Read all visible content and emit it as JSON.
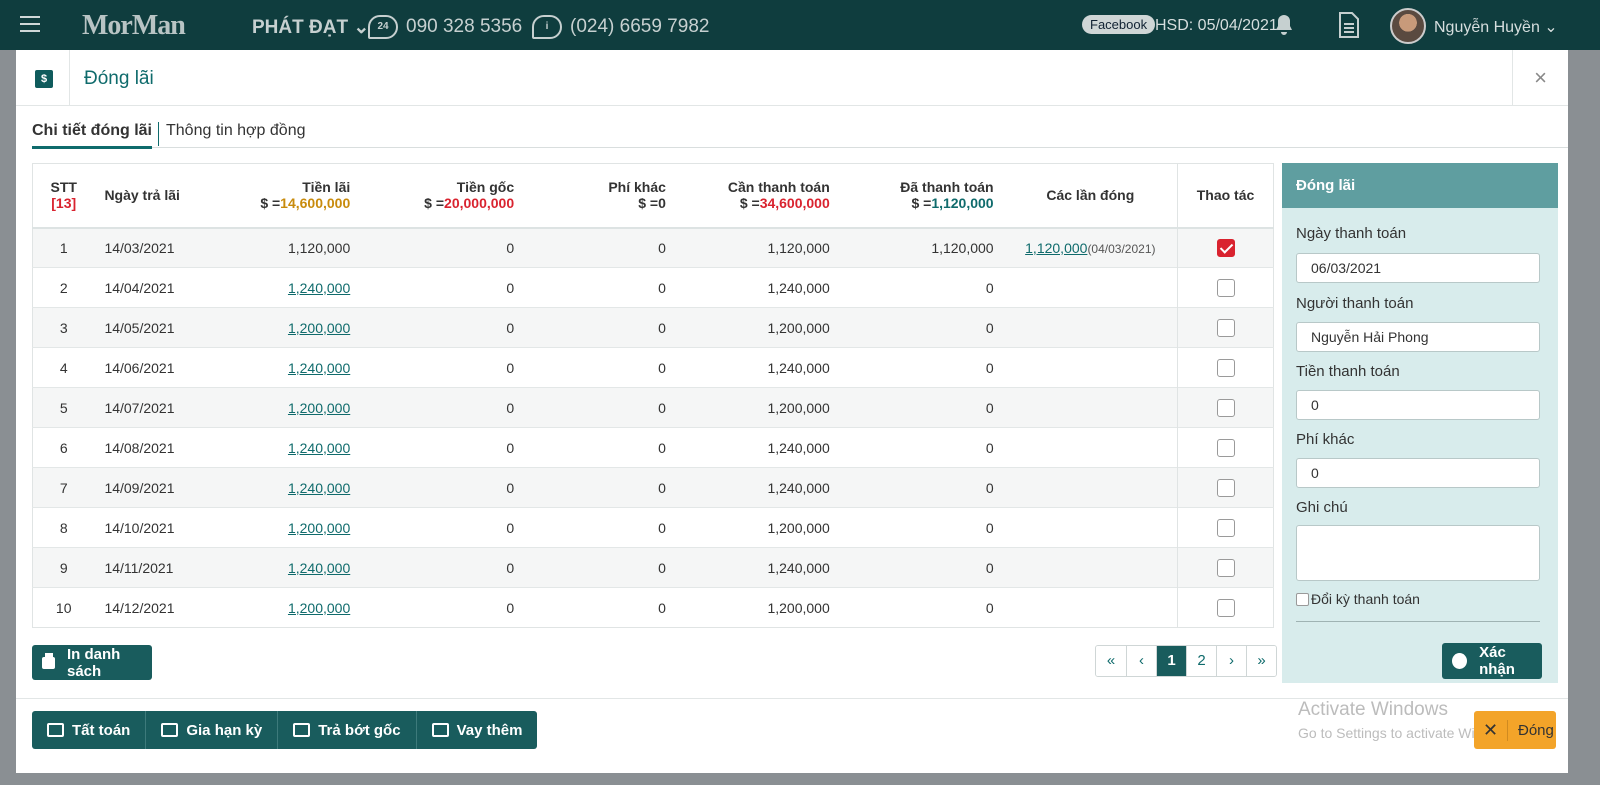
{
  "topbar": {
    "logo": "MorMan",
    "shop": "PHÁT ĐẠT",
    "phone1_badge": "24",
    "phone1": "090 328 5356",
    "phone2": "(024) 6659 7982",
    "facebook": "Facebook",
    "hsd": "HSD: 05/04/2021",
    "user": "Nguyễn Huyền"
  },
  "modal": {
    "icon_text": "$",
    "title": "Đóng lãi",
    "close": "×"
  },
  "tabs": [
    {
      "label": "Chi tiết đóng lãi"
    },
    {
      "label": "Thông tin hợp đồng"
    }
  ],
  "table": {
    "headers": {
      "stt": "STT",
      "stt_count": "[13]",
      "ngay": "Ngày trả lãi",
      "tienlai": "Tiền lãi",
      "tienlai_sum_prefix": "$ =",
      "tienlai_sum": "14,600,000",
      "tiengoc": "Tiền gốc",
      "tiengoc_sum_prefix": "$ =",
      "tiengoc_sum": "20,000,000",
      "phikhac": "Phí khác",
      "phikhac_sum_prefix": "$ =",
      "phikhac_sum": "0",
      "canthanhtoan": "Cần thanh toán",
      "can_sum_prefix": "$ =",
      "can_sum": "34,600,000",
      "dathanhtoan": "Đã thanh toán",
      "da_sum_prefix": "$ =",
      "da_sum": "1,120,000",
      "caclandong": "Các lần đóng",
      "thaotac": "Thao tác"
    },
    "rows": [
      {
        "stt": "1",
        "ngay": "14/03/2021",
        "lai": "1,120,000",
        "goc": "0",
        "phi": "0",
        "can": "1,120,000",
        "da": "1,120,000",
        "lan": "1,120,000",
        "lan_date": "(04/03/2021)"
      },
      {
        "stt": "2",
        "ngay": "14/04/2021",
        "lai": "1,240,000",
        "goc": "0",
        "phi": "0",
        "can": "1,240,000",
        "da": "0",
        "lan": "",
        "lan_date": ""
      },
      {
        "stt": "3",
        "ngay": "14/05/2021",
        "lai": "1,200,000",
        "goc": "0",
        "phi": "0",
        "can": "1,200,000",
        "da": "0",
        "lan": "",
        "lan_date": ""
      },
      {
        "stt": "4",
        "ngay": "14/06/2021",
        "lai": "1,240,000",
        "goc": "0",
        "phi": "0",
        "can": "1,240,000",
        "da": "0",
        "lan": "",
        "lan_date": ""
      },
      {
        "stt": "5",
        "ngay": "14/07/2021",
        "lai": "1,200,000",
        "goc": "0",
        "phi": "0",
        "can": "1,200,000",
        "da": "0",
        "lan": "",
        "lan_date": ""
      },
      {
        "stt": "6",
        "ngay": "14/08/2021",
        "lai": "1,240,000",
        "goc": "0",
        "phi": "0",
        "can": "1,240,000",
        "da": "0",
        "lan": "",
        "lan_date": ""
      },
      {
        "stt": "7",
        "ngay": "14/09/2021",
        "lai": "1,240,000",
        "goc": "0",
        "phi": "0",
        "can": "1,240,000",
        "da": "0",
        "lan": "",
        "lan_date": ""
      },
      {
        "stt": "8",
        "ngay": "14/10/2021",
        "lai": "1,200,000",
        "goc": "0",
        "phi": "0",
        "can": "1,200,000",
        "da": "0",
        "lan": "",
        "lan_date": ""
      },
      {
        "stt": "9",
        "ngay": "14/11/2021",
        "lai": "1,240,000",
        "goc": "0",
        "phi": "0",
        "can": "1,240,000",
        "da": "0",
        "lan": "",
        "lan_date": ""
      },
      {
        "stt": "10",
        "ngay": "14/12/2021",
        "lai": "1,200,000",
        "goc": "0",
        "phi": "0",
        "can": "1,200,000",
        "da": "0",
        "lan": "",
        "lan_date": ""
      }
    ]
  },
  "print_button": "In danh sách",
  "pager": {
    "first": "«",
    "prev": "‹",
    "p1": "1",
    "p2": "2",
    "next": "›",
    "last": "»"
  },
  "side": {
    "title": "Đóng lãi",
    "ngay_label": "Ngày thanh toán",
    "ngay_value": "06/03/2021",
    "nguoi_label": "Người thanh toán",
    "nguoi_value": "Nguyễn Hải Phong",
    "tien_label": "Tiền thanh toán",
    "tien_value": "0",
    "phi_label": "Phí khác",
    "phi_value": "0",
    "ghichu_label": "Ghi chú",
    "doiky_label": "Đổi kỳ thanh toán",
    "confirm": "Xác nhận"
  },
  "footer": {
    "tattoan": "Tất toán",
    "giahan": "Gia hạn kỳ",
    "trabotgoc": "Trả bớt gốc",
    "vaythem": "Vay thêm",
    "activate1": "Activate Windows",
    "activate2": "Go to Settings to activate Windows.",
    "close_x": "✕",
    "close": "Đóng"
  },
  "colors": {
    "primary": "#195c5d",
    "topbar": "#0f3d3e",
    "side_header": "#5f9ea0",
    "side_bg": "#d8ecec",
    "red": "#d9232f",
    "orange": "#c88b0c",
    "close_btn": "#f3a429"
  }
}
